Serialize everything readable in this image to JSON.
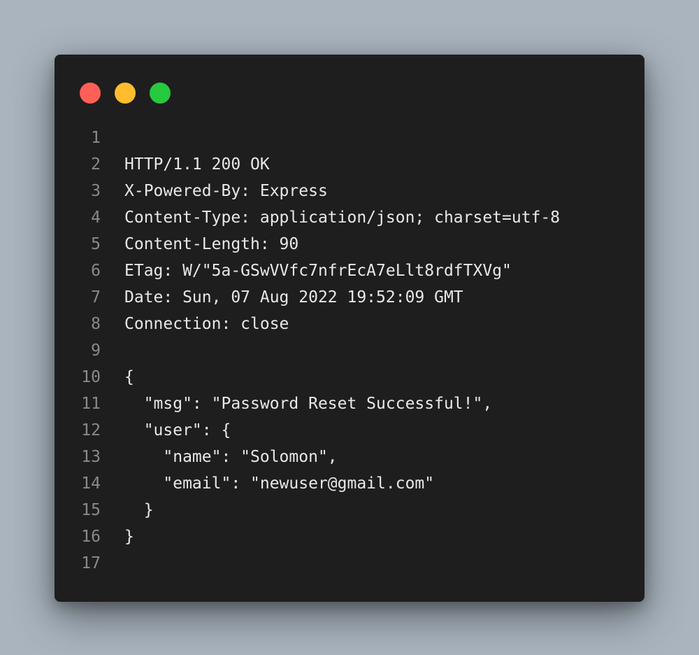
{
  "window": {
    "controls": [
      "close-dot",
      "minimize-dot",
      "maximize-dot"
    ],
    "colors": {
      "close": "#ff5f56",
      "minimize": "#ffbd2e",
      "maximize": "#27c93f",
      "background": "#1e1e1e",
      "page_background": "#a9b4bf",
      "text": "#e8e8e8",
      "line_number": "#8a8a8a"
    }
  },
  "code": {
    "lines": [
      {
        "num": "1",
        "text": ""
      },
      {
        "num": "2",
        "text": "HTTP/1.1 200 OK"
      },
      {
        "num": "3",
        "text": "X-Powered-By: Express"
      },
      {
        "num": "4",
        "text": "Content-Type: application/json; charset=utf-8"
      },
      {
        "num": "5",
        "text": "Content-Length: 90"
      },
      {
        "num": "6",
        "text": "ETag: W/\"5a-GSwVVfc7nfrEcA7eLlt8rdfTXVg\""
      },
      {
        "num": "7",
        "text": "Date: Sun, 07 Aug 2022 19:52:09 GMT"
      },
      {
        "num": "8",
        "text": "Connection: close"
      },
      {
        "num": "9",
        "text": ""
      },
      {
        "num": "10",
        "text": "{"
      },
      {
        "num": "11",
        "text": "  \"msg\": \"Password Reset Successful!\","
      },
      {
        "num": "12",
        "text": "  \"user\": {"
      },
      {
        "num": "13",
        "text": "    \"name\": \"Solomon\","
      },
      {
        "num": "14",
        "text": "    \"email\": \"newuser@gmail.com\""
      },
      {
        "num": "15",
        "text": "  }"
      },
      {
        "num": "16",
        "text": "}"
      },
      {
        "num": "17",
        "text": ""
      }
    ]
  }
}
